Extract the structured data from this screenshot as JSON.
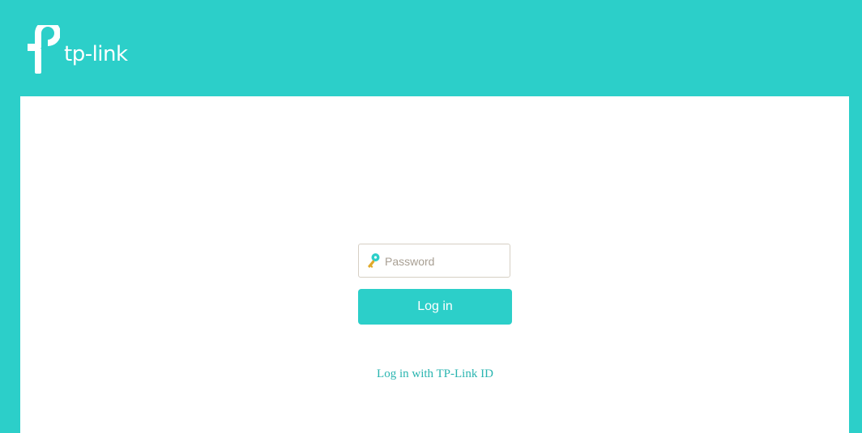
{
  "header": {
    "brand": "tp-link",
    "brand_color": "#2ccfc9",
    "logo_icon": "tp-link-logo-icon"
  },
  "login": {
    "password_placeholder": "Password",
    "password_value": "",
    "key_icon": "key-icon",
    "login_button_label": "Log in",
    "tplink_id_link": "Log in with TP-Link ID"
  },
  "colors": {
    "accent": "#2ccfc9",
    "link": "#2ab5b0",
    "placeholder": "#a89f93"
  }
}
